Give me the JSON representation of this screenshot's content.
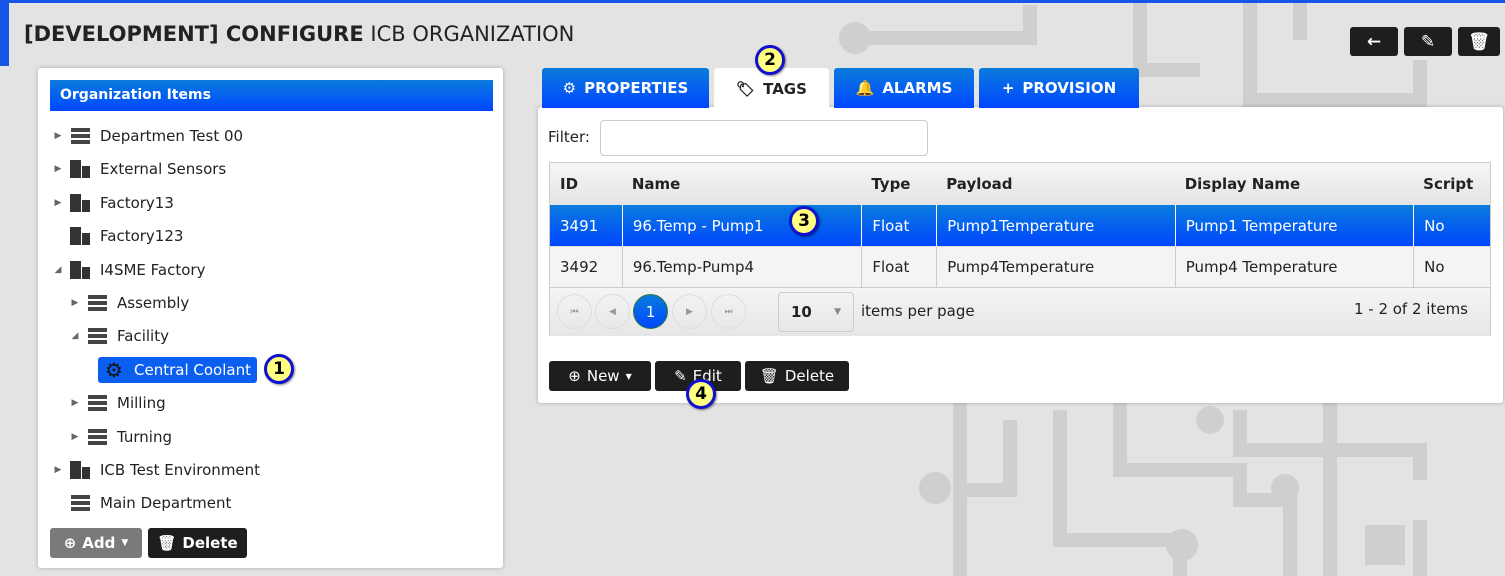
{
  "header": {
    "title_bold": "[DEVELOPMENT] CONFIGURE",
    "title_rest": "ICB ORGANIZATION"
  },
  "toolbar": {
    "back": "back-arrow-icon",
    "edit": "pencil-icon",
    "delete": "trash-icon"
  },
  "tree": {
    "title": "Organization Items",
    "items": [
      {
        "label": "Departmen Test 00",
        "icon": "server",
        "expander": "collapsed",
        "depth": 0
      },
      {
        "label": "External Sensors",
        "icon": "building",
        "expander": "collapsed",
        "depth": 0
      },
      {
        "label": "Factory13",
        "icon": "building",
        "expander": "collapsed",
        "depth": 0
      },
      {
        "label": "Factory123",
        "icon": "building",
        "expander": "none",
        "depth": 0
      },
      {
        "label": "I4SME Factory",
        "icon": "building",
        "expander": "expanded",
        "depth": 0
      },
      {
        "label": "Assembly",
        "icon": "server",
        "expander": "collapsed",
        "depth": 1
      },
      {
        "label": "Facility",
        "icon": "server",
        "expander": "expanded",
        "depth": 1
      },
      {
        "label": "Central Coolant",
        "icon": "gear",
        "expander": "none",
        "depth": 2,
        "selected": true
      },
      {
        "label": "Milling",
        "icon": "server",
        "expander": "collapsed",
        "depth": 1
      },
      {
        "label": "Turning",
        "icon": "server",
        "expander": "collapsed",
        "depth": 1
      },
      {
        "label": "ICB Test Environment",
        "icon": "building",
        "expander": "collapsed",
        "depth": 0
      },
      {
        "label": "Main Department",
        "icon": "server",
        "expander": "none",
        "depth": 0
      }
    ],
    "add_label": "Add",
    "delete_label": "Delete"
  },
  "tabs": [
    {
      "label": "PROPERTIES",
      "icon": "gear"
    },
    {
      "label": "TAGS",
      "icon": "tag",
      "active": true
    },
    {
      "label": "ALARMS",
      "icon": "bell"
    },
    {
      "label": "PROVISION",
      "icon": "plus"
    }
  ],
  "filter": {
    "label": "Filter:",
    "value": ""
  },
  "table": {
    "columns": [
      "ID",
      "Name",
      "Type",
      "Payload",
      "Display Name",
      "Script"
    ],
    "rows": [
      [
        "3491",
        "96.Temp - Pump1",
        "Float",
        "Pump1Temperature",
        "Pump1 Temperature",
        "No"
      ],
      [
        "3492",
        "96.Temp-Pump4",
        "Float",
        "Pump4Temperature",
        "Pump4 Temperature",
        "No"
      ]
    ],
    "selected_row": 0
  },
  "pager": {
    "current_page": "1",
    "page_size": "10",
    "per_page_label": "items per page",
    "summary": "1 - 2 of 2 items"
  },
  "actions": {
    "new": "New",
    "edit": "Edit",
    "delete": "Delete"
  },
  "badges": [
    "1",
    "2",
    "3",
    "4"
  ],
  "colors": {
    "accent": "#0a5ef0",
    "dark_button": "#1e1e1e",
    "background": "#e3e3e3"
  }
}
